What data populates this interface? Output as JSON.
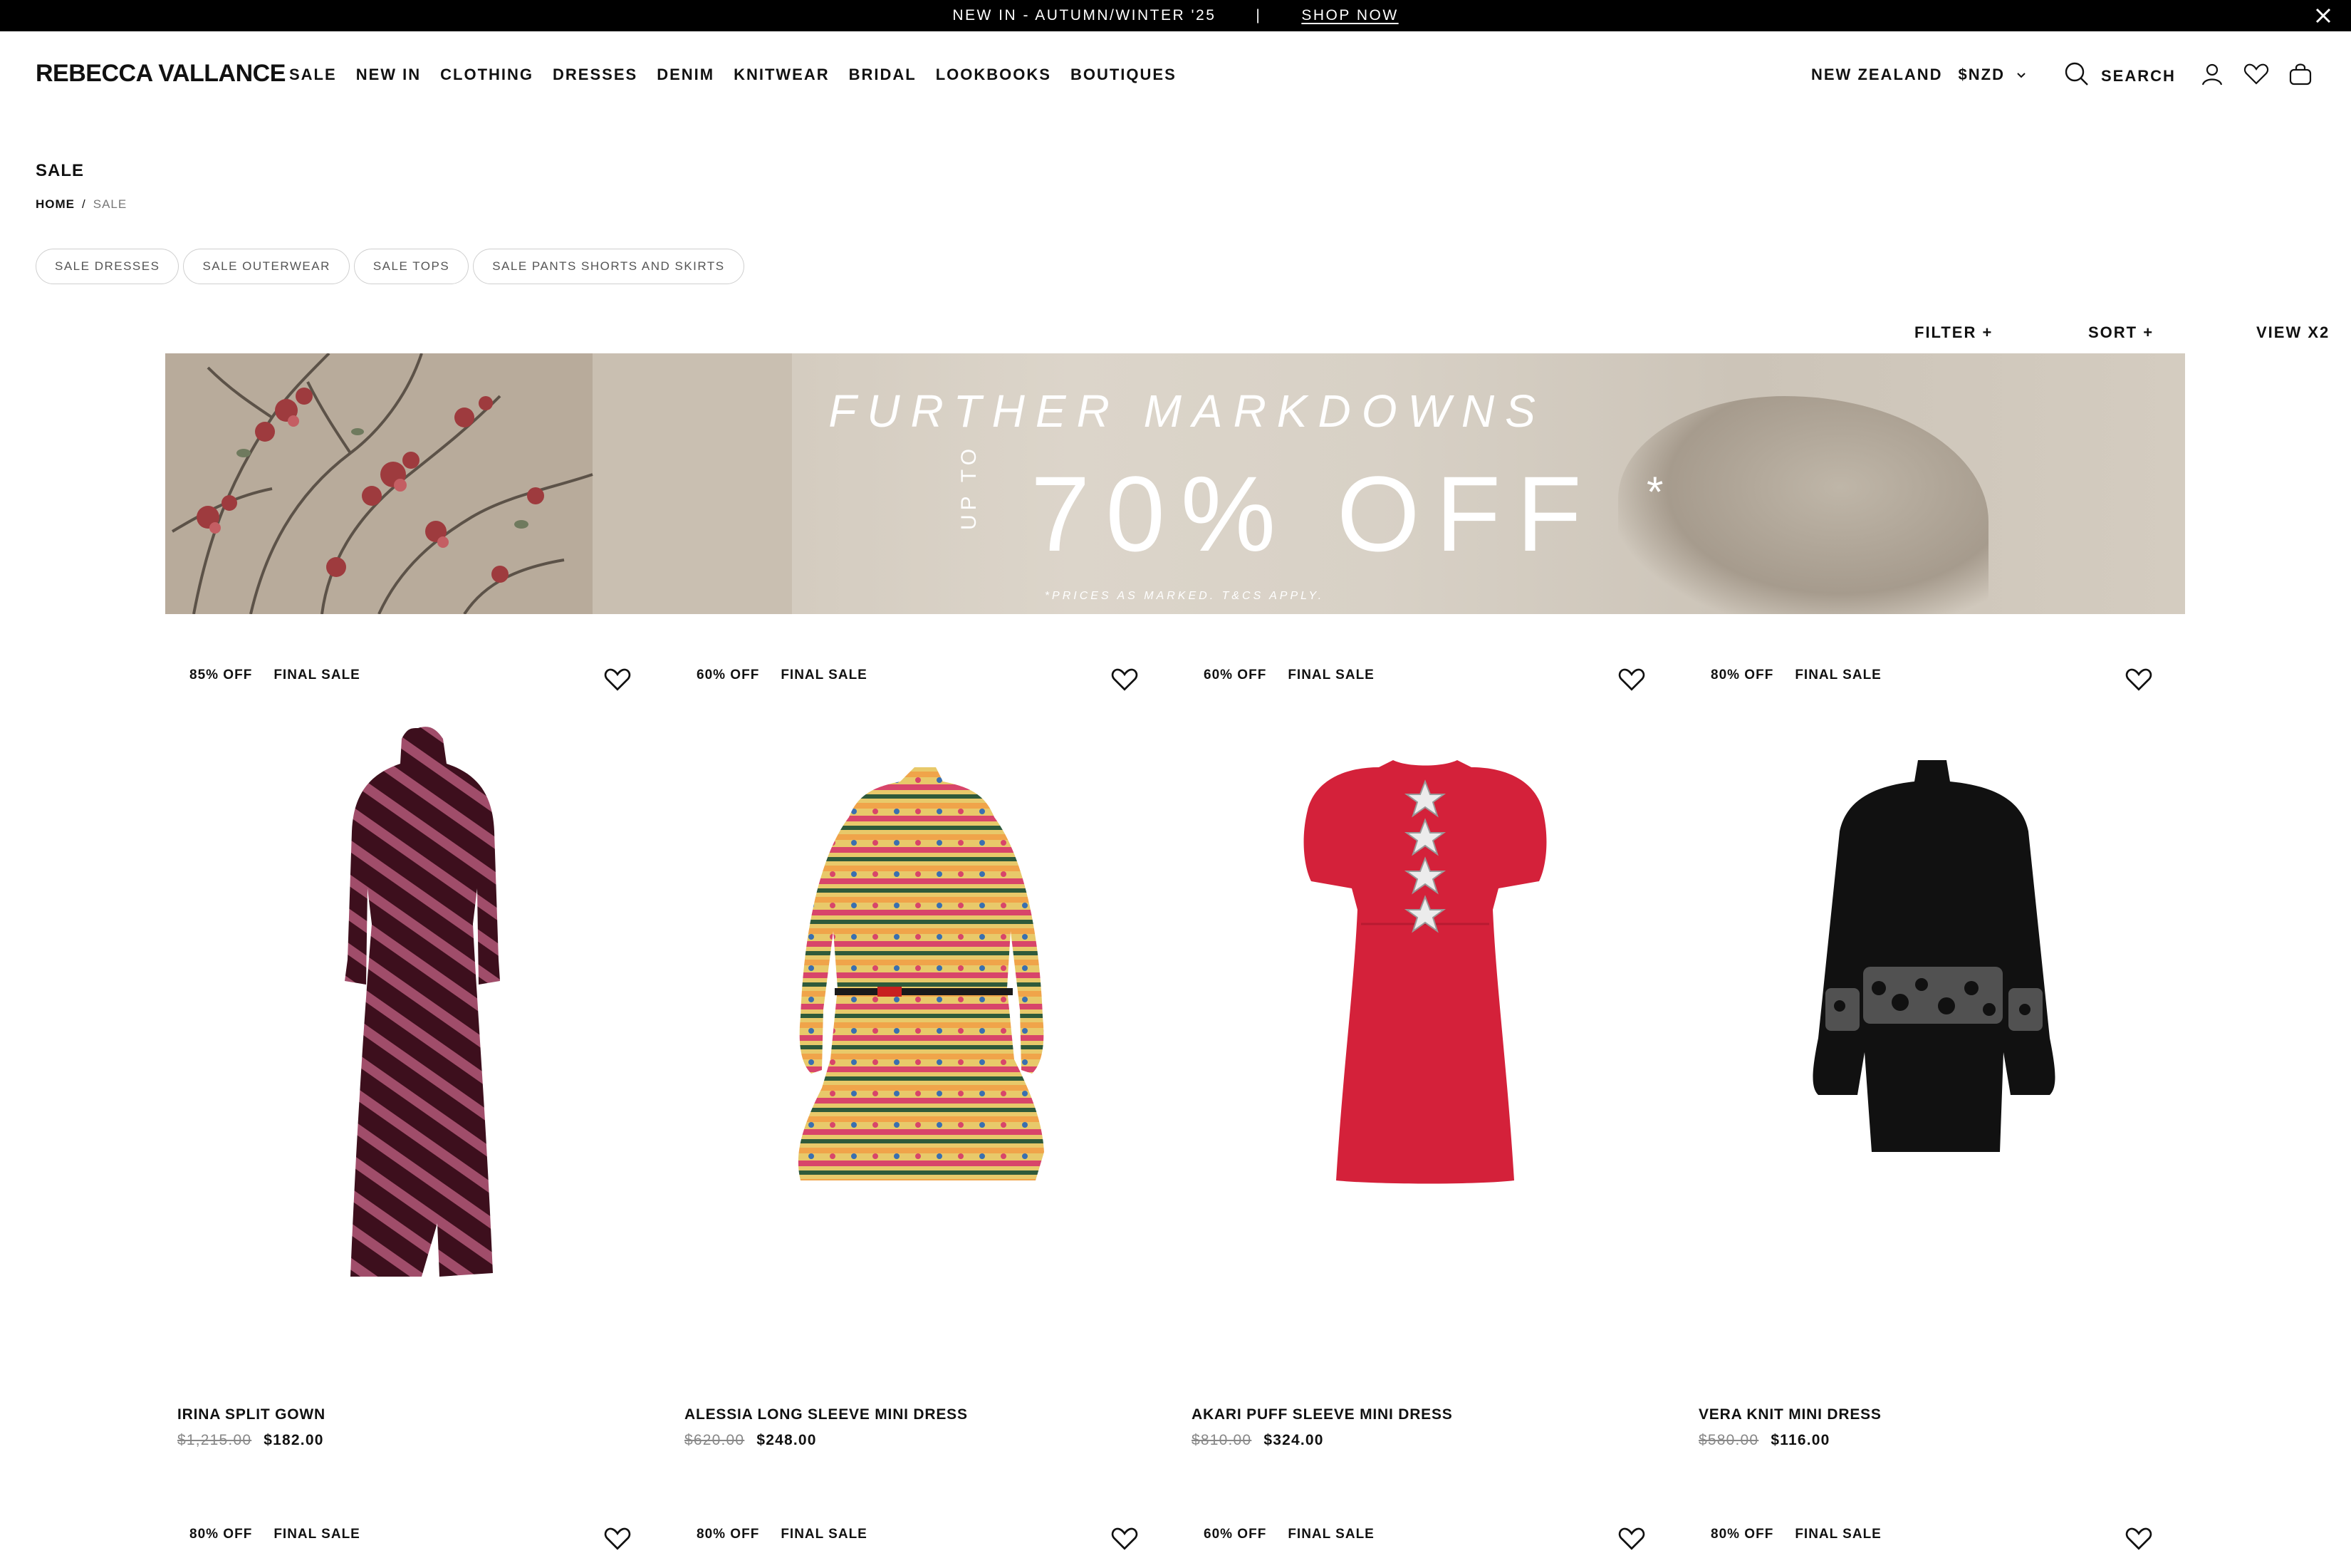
{
  "announcement": {
    "text": "NEW IN - AUTUMN/WINTER '25",
    "separator": "|",
    "link": "SHOP NOW"
  },
  "header": {
    "logo": "REBECCA VALLANCE",
    "nav": [
      "SALE",
      "NEW IN",
      "CLOTHING",
      "DRESSES",
      "DENIM",
      "KNITWEAR",
      "BRIDAL",
      "LOOKBOOKS",
      "BOUTIQUES"
    ],
    "region": "NEW ZEALAND",
    "currency": "$NZD",
    "search_label": "SEARCH",
    "icons": [
      "search-icon",
      "account-icon",
      "wishlist-icon",
      "bag-icon",
      "close-icon",
      "chevron-down-icon"
    ]
  },
  "page": {
    "title": "SALE",
    "breadcrumb": {
      "home": "HOME",
      "separator": "/",
      "current": "SALE"
    },
    "category_pills": [
      "SALE DRESSES",
      "SALE OUTERWEAR",
      "SALE TOPS",
      "SALE PANTS SHORTS AND SKIRTS"
    ],
    "controls": {
      "filter": "FILTER +",
      "sort": "SORT +",
      "view": "VIEW X2"
    }
  },
  "banner": {
    "headline": "FURTHER MARKDOWNS",
    "up_to": "UP TO",
    "offer": "70% OFF",
    "asterisk": "*",
    "note": "*PRICES AS MARKED. T&CS APPLY."
  },
  "products": [
    {
      "discount": "85% OFF",
      "tag": "FINAL SALE",
      "name": "IRINA SPLIT GOWN",
      "was": "$1,215.00",
      "now": "$182.00"
    },
    {
      "discount": "60% OFF",
      "tag": "FINAL SALE",
      "name": "ALESSIA LONG SLEEVE MINI DRESS",
      "was": "$620.00",
      "now": "$248.00"
    },
    {
      "discount": "60% OFF",
      "tag": "FINAL SALE",
      "name": "AKARI PUFF SLEEVE MINI DRESS",
      "was": "$810.00",
      "now": "$324.00"
    },
    {
      "discount": "80% OFF",
      "tag": "FINAL SALE",
      "name": "VERA KNIT MINI DRESS",
      "was": "$580.00",
      "now": "$116.00"
    }
  ],
  "next_row": [
    {
      "discount": "80% OFF",
      "tag": "FINAL SALE"
    },
    {
      "discount": "80% OFF",
      "tag": "FINAL SALE"
    },
    {
      "discount": "60% OFF",
      "tag": "FINAL SALE"
    },
    {
      "discount": "80% OFF",
      "tag": "FINAL SALE"
    }
  ],
  "colors": {
    "black": "#000000",
    "white": "#ffffff",
    "dress_red": "#d4213a",
    "dress_black": "#111111",
    "gown_burgundy": "#4a1526"
  }
}
